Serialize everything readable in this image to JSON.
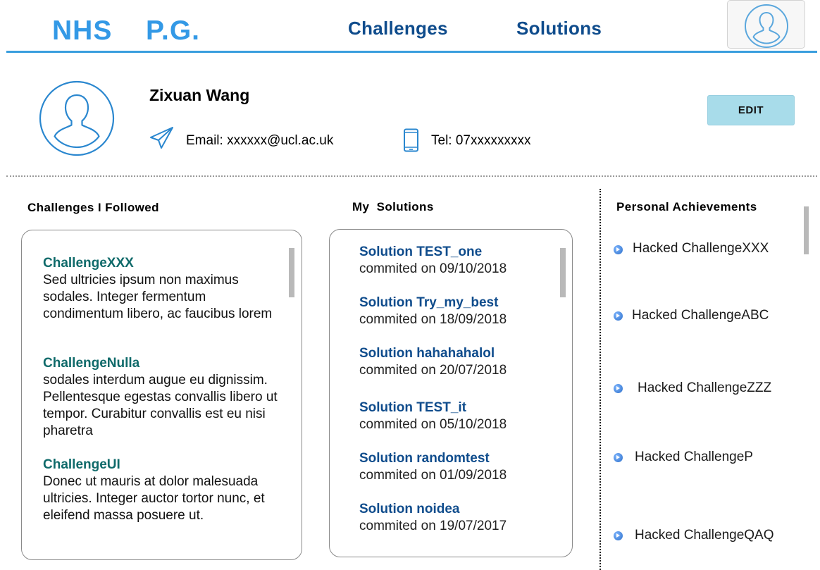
{
  "header": {
    "logo_left": "NHS",
    "logo_right": "P.G.",
    "nav": {
      "challenges": "Challenges",
      "solutions": "Solutions"
    }
  },
  "profile": {
    "name": "Zixuan Wang",
    "email": "Email: xxxxxx@ucl.ac.uk",
    "tel": "Tel: 07xxxxxxxxx",
    "edit_label": "EDIT"
  },
  "challenges_followed": {
    "title": "Challenges I Followed",
    "items": [
      {
        "name": "ChallengeXXX",
        "desc": "Sed ultricies ipsum non maximus sodales. Integer fermentum condimentum libero, ac faucibus lorem"
      },
      {
        "name": "ChallengeNulla",
        "desc": "sodales interdum augue eu dignissim. Pellentesque egestas convallis libero ut tempor. Curabitur convallis est eu nisi pharetra"
      },
      {
        "name": "ChallengeUI",
        "desc": "Donec ut mauris at dolor malesuada ultricies. Integer auctor tortor nunc, et eleifend massa posuere ut."
      }
    ]
  },
  "my_solutions": {
    "title": "My  Solutions",
    "items": [
      {
        "name": "Solution TEST_one",
        "date": "commited on 09/10/2018"
      },
      {
        "name": "Solution Try_my_best",
        "date": "commited on 18/09/2018"
      },
      {
        "name": "Solution hahahahalol",
        "date": "commited on 20/07/2018"
      },
      {
        "name": "Solution TEST_it",
        "date": "commited on 05/10/2018"
      },
      {
        "name": "Solution randomtest",
        "date": "commited on 01/09/2018"
      },
      {
        "name": "Solution noidea",
        "date": "commited on 19/07/2017"
      }
    ]
  },
  "achievements": {
    "title": "Personal Achievements",
    "items": [
      "Hacked ChallengeXXX",
      "Hacked ChallengeABC",
      "Hacked ChallengeZZZ",
      "Hacked ChallengeP",
      "Hacked ChallengeQAQ"
    ]
  },
  "colors": {
    "logo": "#3399e6",
    "nav": "#0f4c8c",
    "header_rule": "#3a9ede",
    "edit_button": "#a8dcea",
    "challenge_title": "#0f6a6a",
    "solution_title": "#0f4c8c"
  },
  "icons": {
    "header_avatar": "user-avatar-icon",
    "profile_avatar": "user-avatar-icon",
    "email": "paper-plane-icon",
    "phone": "mobile-phone-icon",
    "achievement_bullet": "play-circle-icon"
  }
}
